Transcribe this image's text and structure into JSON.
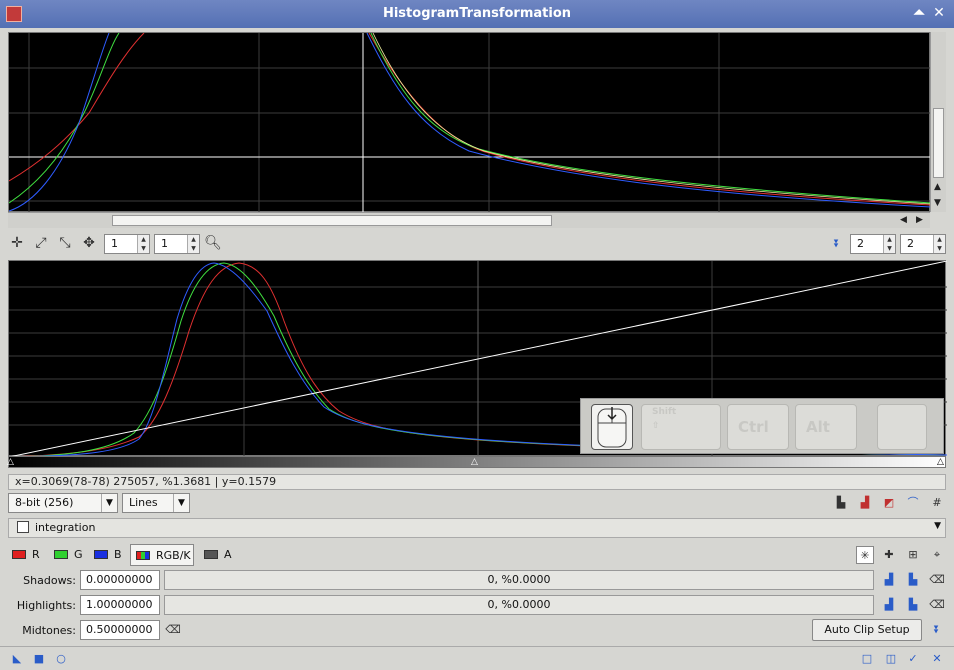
{
  "window": {
    "title": "HistogramTransformation"
  },
  "colors": {
    "red": "#e03030",
    "green": "#40e040",
    "blue": "#2e5cff",
    "white": "#ffffff",
    "titlebar": "#5470b4"
  },
  "icons": {
    "app": "histogram-app-icon",
    "shade": "shade-window-icon",
    "close": "close-window-icon"
  },
  "toolbar": {
    "zoom_h": "1",
    "zoom_v": "1",
    "right_h": "2",
    "right_v": "2"
  },
  "readout": "x=0.3069(78-78) 275057, %1.3681 | y=0.1579",
  "options": {
    "resolution": "8-bit (256)",
    "graph_style": "Lines"
  },
  "view": {
    "name": "integration"
  },
  "channels": [
    {
      "label": "R",
      "color": "#e02020"
    },
    {
      "label": "G",
      "color": "#30d030"
    },
    {
      "label": "B",
      "color": "#1a30e0"
    },
    {
      "label": "RGB/K",
      "color": "#444444"
    },
    {
      "label": "A",
      "color": "#555555"
    }
  ],
  "params": {
    "shadows_label": "Shadows:",
    "shadows_value": "0.00000000",
    "shadows_clip": "0, %0.0000",
    "highlights_label": "Highlights:",
    "highlights_value": "1.00000000",
    "highlights_clip": "0, %0.0000",
    "midtones_label": "Midtones:",
    "midtones_value": "0.50000000",
    "auto_clip_label": "Auto Clip Setup"
  },
  "keys": {
    "shift": "Shift",
    "ctrl": "Ctrl",
    "alt": "Alt"
  },
  "transfer_curve": {
    "midtones": 0.5,
    "shadows": 0.0,
    "highlights": 1.0
  }
}
